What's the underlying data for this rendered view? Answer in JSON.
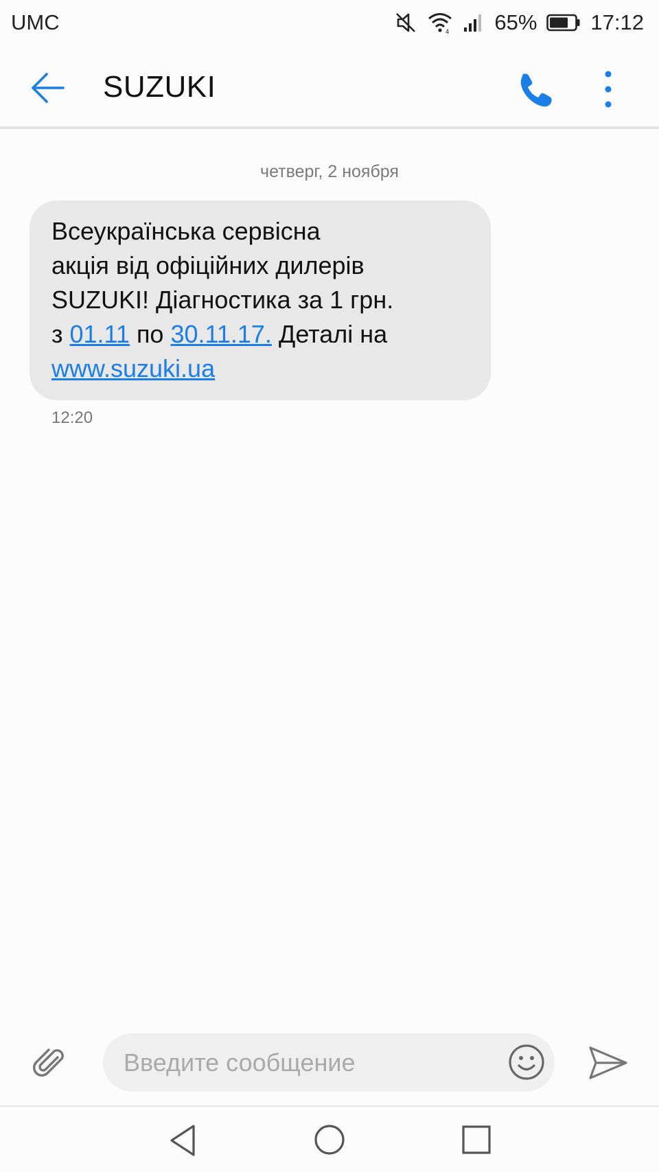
{
  "status_bar": {
    "carrier": "UMC",
    "battery_percent": "65%",
    "time": "17:12",
    "icons": [
      "mute-icon",
      "wifi-icon",
      "signal-icon",
      "battery-icon"
    ]
  },
  "header": {
    "contact_name": "SUZUKI",
    "icons": [
      "back-arrow-icon",
      "phone-icon",
      "more-vert-icon"
    ],
    "accent_color": "#1a7ee6"
  },
  "conversation": {
    "date_divider": "четверг, 2 ноября",
    "message": {
      "line1": "Всеукраїнська сервісна",
      "line2": "акція від офіційних дилерів",
      "line3": "SUZUKI! Діагностика за 1 грн.",
      "line4_prefix": "з ",
      "link_date_from": "01.11",
      "line4_mid": " по ",
      "link_date_to": "30.11.17.",
      "line4_suffix": " Деталі на",
      "link_url": "www.suzuki.ua",
      "time": "12:20"
    }
  },
  "composer": {
    "placeholder": "Введите сообщение",
    "value": "",
    "icons": [
      "paperclip-icon",
      "emoji-icon",
      "send-icon"
    ]
  },
  "nav_bar": {
    "icons": [
      "nav-back-icon",
      "nav-home-icon",
      "nav-recents-icon"
    ]
  }
}
